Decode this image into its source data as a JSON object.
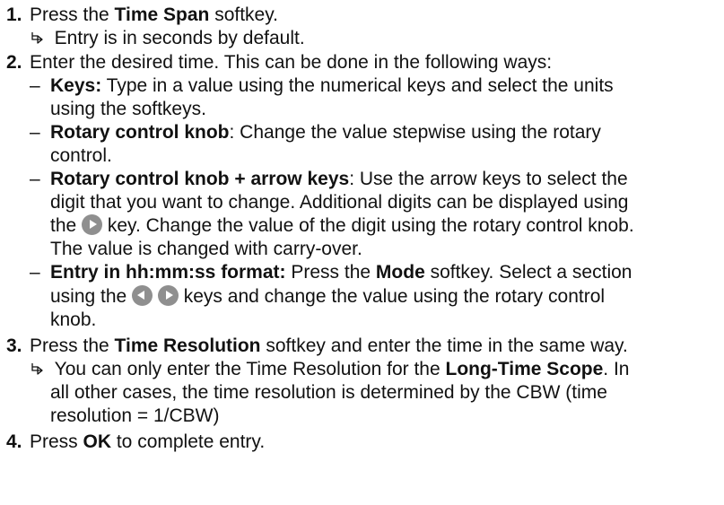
{
  "step1": {
    "num": "1.",
    "pre": "Press the ",
    "bold": "Time Span",
    "post": " softkey.",
    "result": "Entry is in seconds by default."
  },
  "step2": {
    "num": "2.",
    "text": "Enter the desired time. This can be done in the following ways:",
    "keys": {
      "bold": "Keys:",
      "l1": " Type in a value using the numerical keys and select the units",
      "l2": "using the softkeys."
    },
    "rotary": {
      "bold": "Rotary control knob",
      "l1": ": Change the value stepwise using the rotary",
      "l2": "control."
    },
    "arrows": {
      "bold": "Rotary control knob + arrow keys",
      "l1": ": Use the arrow keys to select the",
      "l2": "digit that you want to change. Additional digits can be displayed using",
      "l3a": "the ",
      "l3b": " key. Change the value of the digit using the rotary control knob.",
      "l4": "The value is changed with carry-over."
    },
    "hhmmss": {
      "bold": "Entry in hh:mm:ss format:",
      "l1a": " Press the ",
      "l1b": "Mode",
      "l1c": " softkey. Select a section",
      "l2a": "using the ",
      "l2b": " keys and change the value using the rotary control",
      "l3": "knob."
    },
    "dash": "–"
  },
  "step3": {
    "num": "3.",
    "pre": "Press the ",
    "bold": "Time Resolution",
    "post": " softkey and enter the time in the same way.",
    "r1a": "You can only enter the Time Resolution for the ",
    "r1b": "Long-Time Scope",
    "r1c": ". In",
    "r2": "all other cases, the time resolution is determined by the CBW (time",
    "r3": "resolution = 1/CBW)"
  },
  "step4": {
    "num": "4.",
    "pre": "Press ",
    "bold": "OK",
    "post": " to complete entry."
  },
  "icons": {
    "result": "result-arrow-icon",
    "right_key": "right-arrow-key-icon",
    "left_key": "left-arrow-key-icon"
  }
}
